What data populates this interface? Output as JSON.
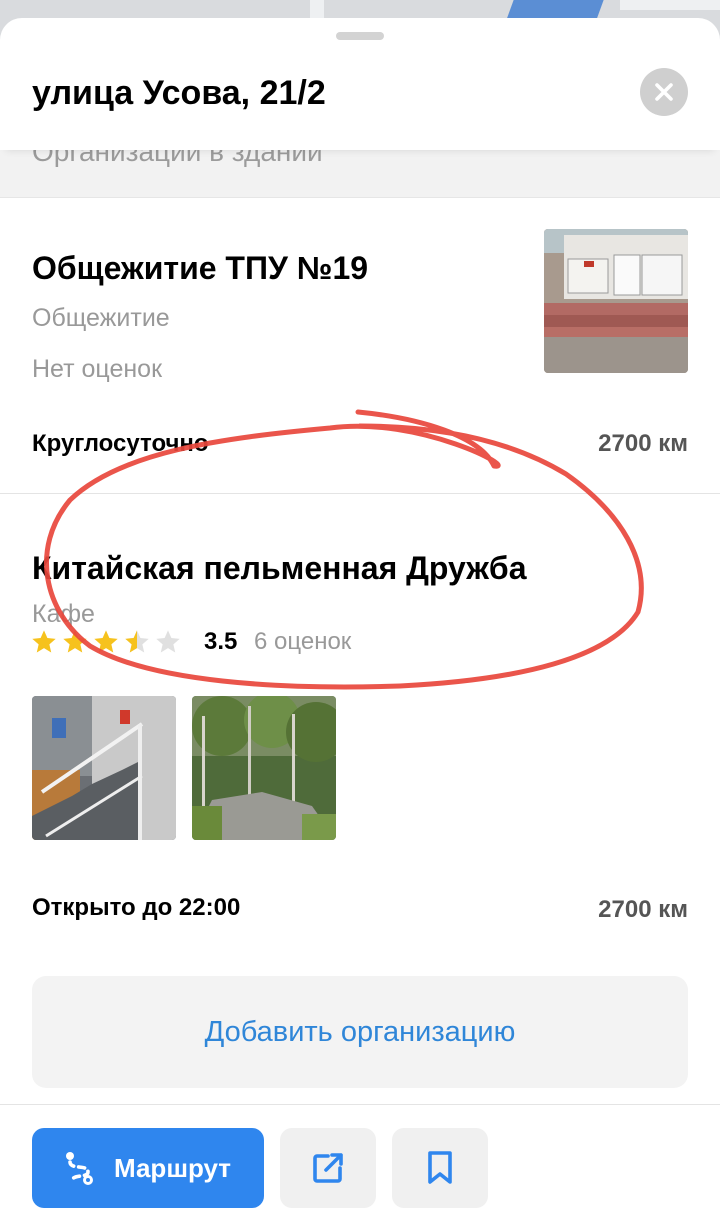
{
  "colors": {
    "accent": "#2f86ee",
    "link": "#2f86d8",
    "star_filled": "#f6c21d",
    "star_empty": "#e0e0e0",
    "annotation_red": "#e8473c"
  },
  "header": {
    "title": "улица Усова, 21/2",
    "close_icon": "close-icon"
  },
  "section": {
    "label": "Организации в здании"
  },
  "organizations": [
    {
      "name": "Общежитие ТПУ №19",
      "category": "Общежитие",
      "rating_text": "Нет оценок",
      "hours": "Круглосуточно",
      "distance": "2700 км"
    },
    {
      "name": "Китайская пельменная Дружба",
      "category": "Кафе",
      "rating": "3.5",
      "rating_fraction": 0.7,
      "reviews": "6 оценок",
      "hours": "Открыто до 22:00",
      "distance": "2700 км"
    }
  ],
  "add_org": {
    "label": "Добавить организацию"
  },
  "toolbar": {
    "route_label": "Маршрут",
    "route_icon": "route-icon",
    "share_icon": "share-icon",
    "bookmark_icon": "bookmark-icon"
  }
}
